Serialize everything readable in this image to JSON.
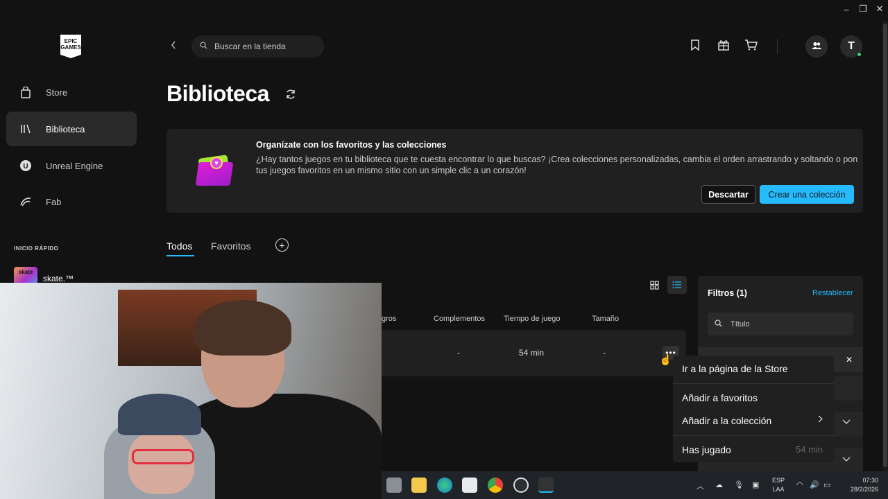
{
  "window": {
    "minimize": "–",
    "restore": "❐",
    "close": "✕"
  },
  "sidebar": {
    "logo": "EPIC GAMES",
    "items": [
      {
        "label": "Store",
        "icon": "bag-icon"
      },
      {
        "label": "Biblioteca",
        "icon": "library-icon"
      },
      {
        "label": "Unreal Engine",
        "icon": "unreal-icon"
      },
      {
        "label": "Fab",
        "icon": "fab-icon"
      }
    ],
    "quick_title": "INICIO RÁPIDO",
    "quick_items": [
      {
        "label": "skate.™",
        "thumb": "skate"
      }
    ]
  },
  "topbar": {
    "search_placeholder": "Buscar en la tienda",
    "avatar_initial": "T"
  },
  "page": {
    "title": "Biblioteca"
  },
  "banner": {
    "title": "Organízate con los favoritos y las colecciones",
    "text": "¿Hay tantos juegos en tu biblioteca que te cuesta encontrar lo que buscas? ¡Crea colecciones personalizadas, cambia el orden arrastrando y soltando o pon tus juegos favoritos en un mismo sitio con un simple clic a un corazón!",
    "discard": "Descartar",
    "create": "Crear una colección"
  },
  "tabs": [
    {
      "label": "Todos"
    },
    {
      "label": "Favoritos"
    }
  ],
  "table": {
    "headers": [
      "gros",
      "Complementos",
      "Tiempo de juego",
      "Tamaño"
    ],
    "row": {
      "complementos": "-",
      "tiempo": "54 min",
      "tamano": "-"
    }
  },
  "filters": {
    "title": "Filtros (1)",
    "reset": "Restablecer",
    "search_placeholder": "Título"
  },
  "context_menu": {
    "items": [
      "Ir a la página de la Store",
      "Añadir a favoritos",
      "Añadir a la colección",
      "Has jugado"
    ],
    "played_value": "54 min"
  },
  "taskbar": {
    "lang": [
      "ESP",
      "LAA"
    ],
    "time": "07:30",
    "date": "28/2/2026"
  }
}
